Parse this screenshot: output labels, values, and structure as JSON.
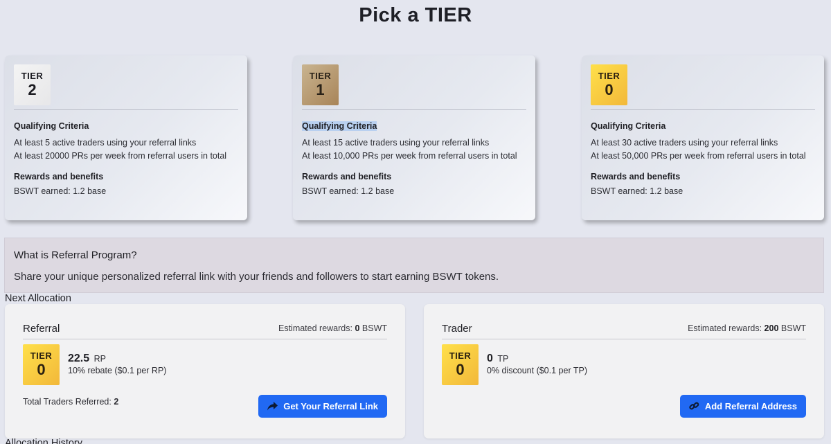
{
  "page": {
    "title": "Pick a TIER"
  },
  "tiers": [
    {
      "badge_label": "TIER",
      "badge_number": "2",
      "badge_color": "#eeeeef",
      "criteria_heading": "Qualifying Criteria",
      "criteria": [
        "At least 5 active traders using your referral links",
        "At least 20000 PRs per week from referral users in total"
      ],
      "rewards_heading": "Rewards and benefits",
      "rewards": "BSWT earned: 1.2 base"
    },
    {
      "badge_label": "TIER",
      "badge_number": "1",
      "badge_color": "#b89a6f",
      "criteria_heading": "Qualifying Criteria",
      "criteria": [
        "At least 15 active traders using your referral links",
        "At least 10,000 PRs per week from referral users in total"
      ],
      "rewards_heading": "Rewards and benefits",
      "rewards": "BSWT earned: 1.2 base"
    },
    {
      "badge_label": "TIER",
      "badge_number": "0",
      "badge_color": "#f7c83f",
      "criteria_heading": "Qualifying Criteria",
      "criteria": [
        "At least 30 active traders using your referral links",
        "At least 50,000 PRs per week from referral users in total"
      ],
      "rewards_heading": "Rewards and benefits",
      "rewards": "BSWT earned: 1.2 base"
    }
  ],
  "referral_program": {
    "title": "What is Referral Program?",
    "description": "Share your unique personalized referral link with your friends and followers to start earning BSWT tokens."
  },
  "next_allocation": {
    "label": "Next Allocation",
    "referral": {
      "title": "Referral",
      "est_prefix": "Estimated rewards:",
      "est_value": "0",
      "est_unit": "BSWT",
      "badge_label": "TIER",
      "badge_number": "0",
      "points": "22.5",
      "points_unit": "RP",
      "rebate": "10% rebate ($0.1 per RP)",
      "traders_prefix": "Total Traders Referred:",
      "traders_value": "2",
      "button_label": "Get Your Referral Link",
      "button_icon": "share-arrow-icon"
    },
    "trader": {
      "title": "Trader",
      "est_prefix": "Estimated rewards:",
      "est_value": "200",
      "est_unit": "BSWT",
      "badge_label": "TIER",
      "badge_number": "0",
      "points": "0",
      "points_unit": "TP",
      "rebate": "0% discount ($0.1 per TP)",
      "button_label": "Add Referral Address",
      "button_icon": "link-icon"
    }
  },
  "allocation_history": {
    "label": "Allocation History"
  },
  "colors": {
    "accent_button": "#2169f3",
    "highlight": "#b9d0f0",
    "background": "#e4e6ef"
  }
}
